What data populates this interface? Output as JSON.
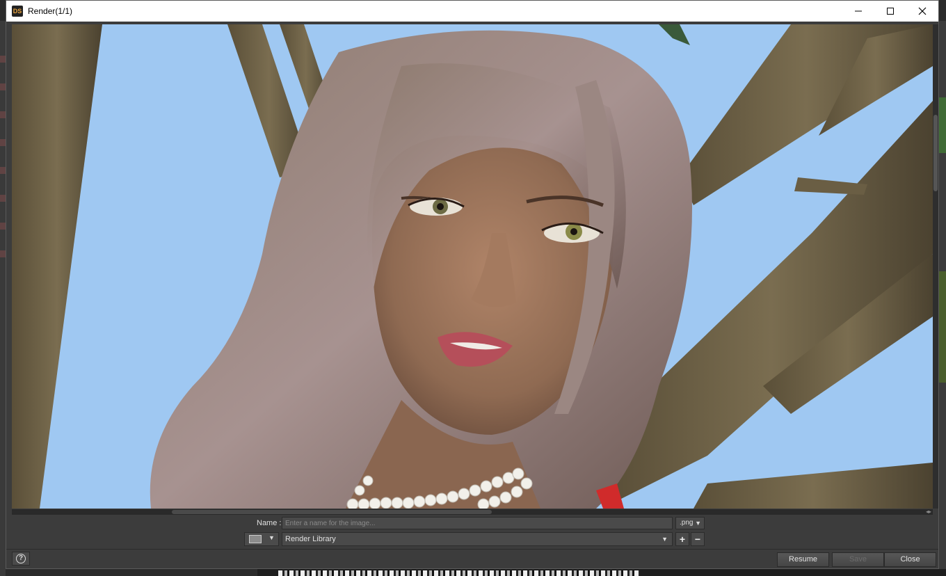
{
  "window": {
    "title": "Render(1/1)",
    "app_icon": "DS"
  },
  "viewport": {
    "content": "rendered-image",
    "background_color": "#9fc8f2"
  },
  "name_row": {
    "label": "Name :",
    "placeholder": "Enter a name for the image...",
    "value": "",
    "extension": ".png"
  },
  "library_row": {
    "selected": "Render Library"
  },
  "footer": {
    "resume_label": "Resume",
    "save_label": "Save",
    "close_label": "Close"
  },
  "icons": {
    "app": "daz-studio-icon",
    "minimize": "minimize-icon",
    "maximize": "maximize-icon",
    "close": "close-icon",
    "help": "help-icon",
    "library": "image-library-icon",
    "add": "plus-icon",
    "remove": "minus-icon"
  }
}
